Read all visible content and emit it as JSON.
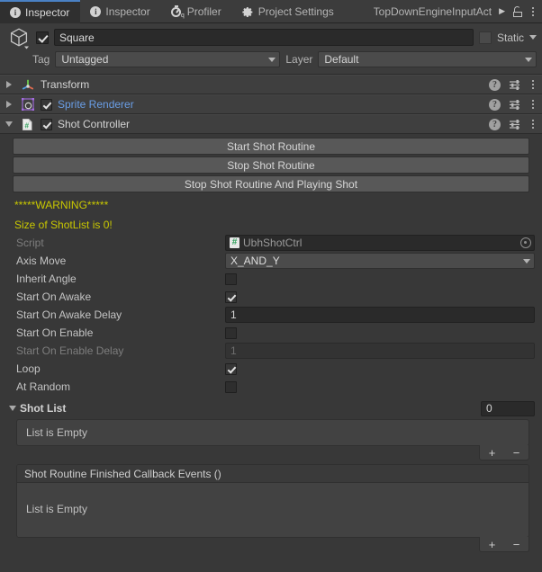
{
  "tabbar": {
    "tabs": [
      {
        "label": "Inspector",
        "icon": "info-icon",
        "active": true
      },
      {
        "label": "Inspector",
        "icon": "info-icon",
        "active": false
      },
      {
        "label": "Profiler",
        "icon": "profiler-icon",
        "active": false
      },
      {
        "label": "Project Settings",
        "icon": "gear-icon",
        "active": false
      }
    ],
    "overflow_tab_label": "TopDownEngineInputAct",
    "overflow_arrow": "▶",
    "lock_icon": "lock-icon",
    "menu_icon": "kebab-menu-icon"
  },
  "gameobject": {
    "enabled": true,
    "name": "Square",
    "static_label": "Static",
    "static_checked": false,
    "tag_label": "Tag",
    "tag_value": "Untagged",
    "layer_label": "Layer",
    "layer_value": "Default"
  },
  "components": [
    {
      "name": "Transform",
      "icon": "transform-gizmo-icon",
      "expanded": false,
      "has_enable_toggle": false,
      "enabled": false,
      "link_style": false
    },
    {
      "name": "Sprite Renderer",
      "icon": "sprite-renderer-icon",
      "expanded": false,
      "has_enable_toggle": true,
      "enabled": true,
      "link_style": true
    },
    {
      "name": "Shot Controller",
      "icon": "csharp-script-icon",
      "expanded": true,
      "has_enable_toggle": true,
      "enabled": true,
      "link_style": false
    }
  ],
  "shot_controller": {
    "buttons": [
      "Start Shot Routine",
      "Stop Shot Routine",
      "Stop Shot Routine And Playing Shot"
    ],
    "warning_lines": [
      "*****WARNING*****",
      "Size of ShotList is 0!"
    ],
    "warning_color": "#c9c800",
    "properties": [
      {
        "label": "Script",
        "type": "object",
        "value": "UbhShotCtrl",
        "dimmed": true,
        "icon": "csharp-script-icon"
      },
      {
        "label": "Axis Move",
        "type": "enum",
        "value": "X_AND_Y",
        "dimmed": false
      },
      {
        "label": "Inherit Angle",
        "type": "bool",
        "value": false,
        "dimmed": false
      },
      {
        "label": "Start On Awake",
        "type": "bool",
        "value": true,
        "dimmed": false
      },
      {
        "label": "Start On Awake Delay",
        "type": "number",
        "value": "1",
        "dimmed": false
      },
      {
        "label": "Start On Enable",
        "type": "bool",
        "value": false,
        "dimmed": false
      },
      {
        "label": "Start On Enable Delay",
        "type": "number",
        "value": "1",
        "dimmed": true
      },
      {
        "label": "Loop",
        "type": "bool",
        "value": true,
        "dimmed": false
      },
      {
        "label": "At Random",
        "type": "bool",
        "value": false,
        "dimmed": false
      }
    ],
    "shot_list": {
      "title": "Shot List",
      "expanded": true,
      "size": "0",
      "empty_text": "List is Empty",
      "add_label": "+",
      "remove_label": "−"
    },
    "callback_events": {
      "title": "Shot Routine Finished Callback Events ()",
      "empty_text": "List is Empty",
      "add_label": "+",
      "remove_label": "−"
    }
  }
}
